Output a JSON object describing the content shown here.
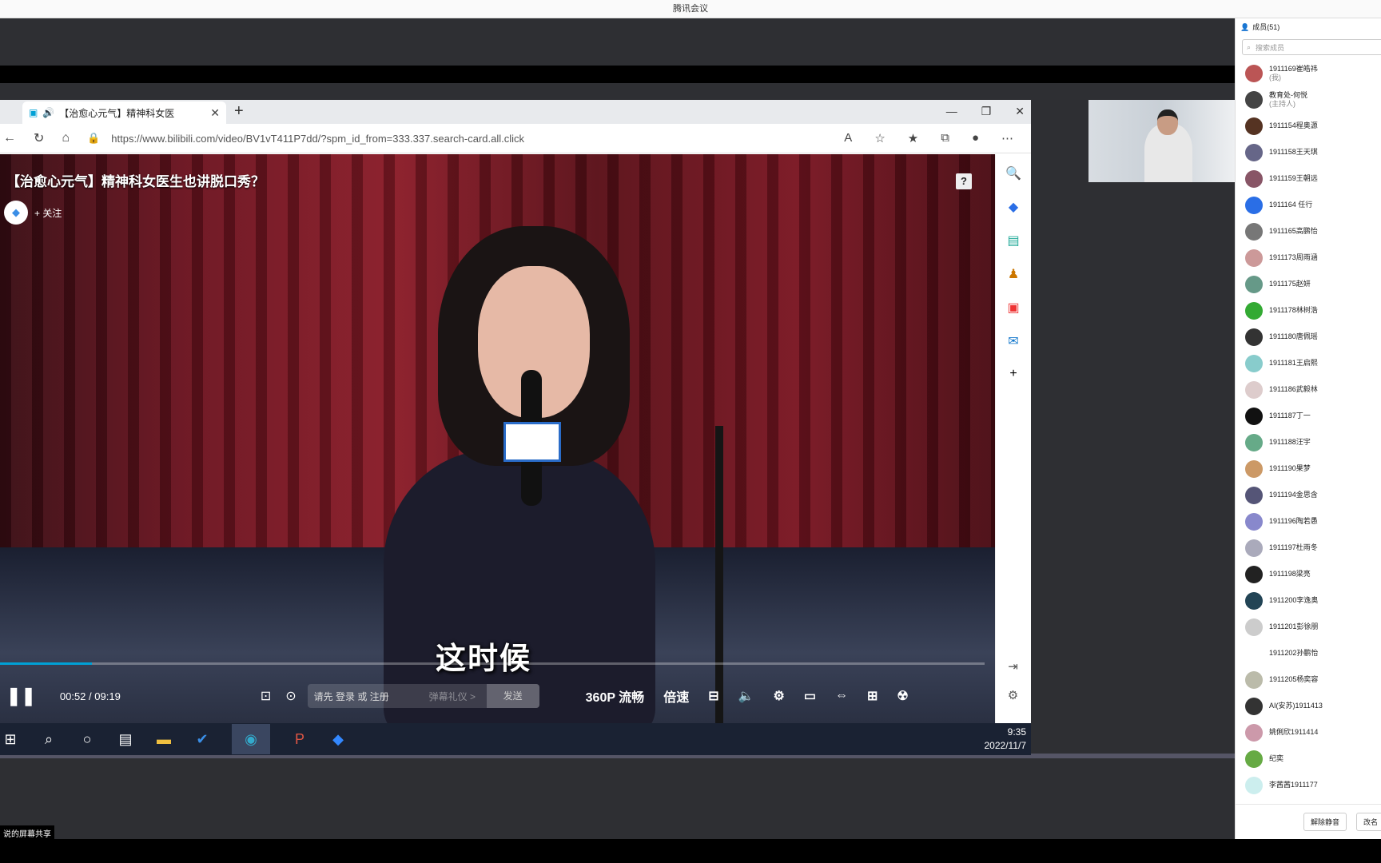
{
  "app": {
    "title": "腾讯会议",
    "share_label": "说的屏幕共享"
  },
  "browser": {
    "tab_title": "【治愈心元气】精神科女医",
    "url": "https://www.bilibili.com/video/BV1vT411P7dd/?spm_id_from=333.337.search-card.all.click"
  },
  "video": {
    "title": "【治愈心元气】精神科女医生也讲脱口秀？",
    "follow_label": "关注",
    "subtitle": "这时候",
    "time_current": "00:52",
    "time_separator": "/",
    "time_total": "09:19",
    "progress": 0.093,
    "danmaku_placeholder": "请先 登录 或 注册",
    "danmaku_etiquette": "弹幕礼仪 >",
    "send_label": "发送",
    "quality_label": "360P 流畅",
    "speed_label": "倍速"
  },
  "taskbar": {
    "time": "9:35",
    "date": "2022/11/7"
  },
  "panel": {
    "members_title": "成员(51)",
    "search_placeholder": "搜索成员",
    "members": [
      {
        "name": "1911169崔皓祎",
        "sub": "(我)",
        "color": "#b55"
      },
      {
        "name": "教育处-何悦",
        "sub": "(主持人)",
        "color": "#444"
      },
      {
        "name": "1911154程奥源",
        "sub": "",
        "color": "#532"
      },
      {
        "name": "1911158王天琪",
        "sub": "",
        "color": "#668"
      },
      {
        "name": "1911159王朝远",
        "sub": "",
        "color": "#856"
      },
      {
        "name": "1911164 任行",
        "sub": "",
        "color": "#2a6ee6"
      },
      {
        "name": "1911165高鹏怡",
        "sub": "",
        "color": "#777"
      },
      {
        "name": "1911173周雨涵",
        "sub": "",
        "color": "#c99"
      },
      {
        "name": "1911175赵妍",
        "sub": "",
        "color": "#698"
      },
      {
        "name": "1911178林树浩",
        "sub": "",
        "color": "#3a3"
      },
      {
        "name": "1911180唐佩瑶",
        "sub": "",
        "color": "#333"
      },
      {
        "name": "1911181王启熙",
        "sub": "",
        "color": "#8cc"
      },
      {
        "name": "1911186武毅林",
        "sub": "",
        "color": "#dcc"
      },
      {
        "name": "1911187丁一",
        "sub": "",
        "color": "#111"
      },
      {
        "name": "1911188汪宇",
        "sub": "",
        "color": "#6a8"
      },
      {
        "name": "1911190果梦",
        "sub": "",
        "color": "#c96"
      },
      {
        "name": "1911194金思含",
        "sub": "",
        "color": "#557"
      },
      {
        "name": "1911196陶若愚",
        "sub": "",
        "color": "#88c"
      },
      {
        "name": "1911197杜雨冬",
        "sub": "",
        "color": "#aab"
      },
      {
        "name": "1911198梁亮",
        "sub": "",
        "color": "#222"
      },
      {
        "name": "1911200李逸奥",
        "sub": "",
        "color": "#245"
      },
      {
        "name": "1911201彭徐朋",
        "sub": "",
        "color": "#ccc"
      },
      {
        "name": "1911202孙鹏怡",
        "sub": "",
        "color": "#fff"
      },
      {
        "name": "1911205杨奕容",
        "sub": "",
        "color": "#bba"
      },
      {
        "name": "AI(安苏)1911413",
        "sub": "",
        "color": "#333"
      },
      {
        "name": "姚俐欣1911414",
        "sub": "",
        "color": "#c9a"
      },
      {
        "name": "纪奕",
        "sub": "",
        "color": "#6a4"
      },
      {
        "name": "李茜茜1911177",
        "sub": "",
        "color": "#cee"
      }
    ],
    "unmute_all_label": "解除静音",
    "more_label": "改名"
  }
}
